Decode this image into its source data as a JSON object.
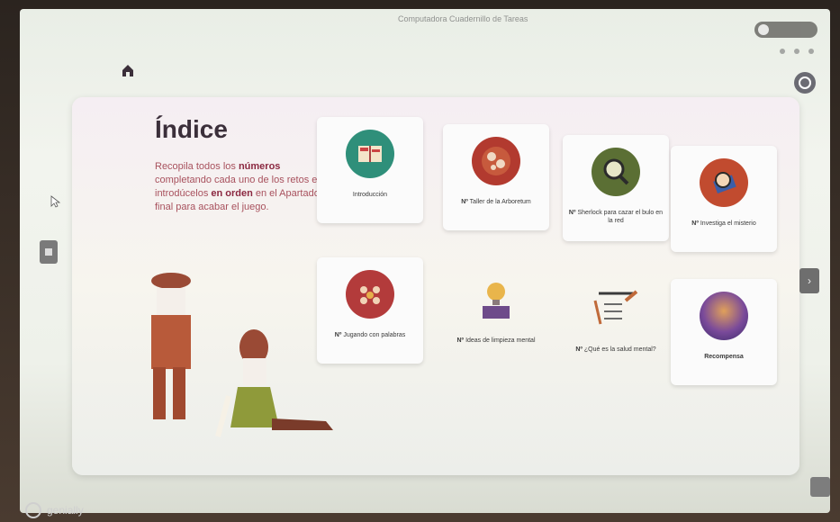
{
  "window": {
    "title": "Computadora Cuadernillo de Tareas"
  },
  "page": {
    "title": "Índice",
    "description_parts": [
      {
        "text": "Recopila todos los ",
        "bold": false
      },
      {
        "text": "números",
        "bold": true
      },
      {
        "text": " completando cada uno de los retos e introdúcelos ",
        "bold": false
      },
      {
        "text": "en orden",
        "bold": true
      },
      {
        "text": " en el Apartado final para acabar el juego.",
        "bold": false
      }
    ]
  },
  "tiles": [
    {
      "num": "",
      "label": "Introducción",
      "color": "#2f8f7a"
    },
    {
      "num": "Nº",
      "label": "Taller de la Arboretum",
      "color": "#b23a2f"
    },
    {
      "num": "Nº",
      "label": "Sherlock para cazar el bulo en la red",
      "color": "#5b6f34"
    },
    {
      "num": "Nº",
      "label": "Investiga el misterio",
      "color": "#c14b2f"
    },
    {
      "num": "Nº",
      "label": "Jugando con palabras",
      "color": "#b33b3b"
    },
    {
      "num": "Nº",
      "label": "Ideas de limpieza mental",
      "color": "#d9a64b"
    },
    {
      "num": "Nº",
      "label": "¿Qué es la salud mental?",
      "color": "#6c6c6c"
    },
    {
      "num": "",
      "label": "Recompensa",
      "color": "#6a3c8a"
    }
  ],
  "brand": {
    "name": "genially"
  },
  "icons": [
    "home-icon",
    "settings-circle-icon",
    "arrow-left-icon",
    "arrow-right-icon",
    "fullscreen-icon"
  ]
}
